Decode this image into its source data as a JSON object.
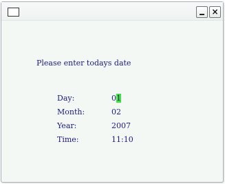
{
  "window": {
    "minimize_label": "_",
    "close_label": "×"
  },
  "prompt": "Please enter todays date",
  "fields": {
    "day": {
      "label": "Day:",
      "value_prefix": "0",
      "value_cursor": "1"
    },
    "month": {
      "label": "Month:",
      "value": "02"
    },
    "year": {
      "label": "Year:",
      "value": "2007"
    },
    "time": {
      "label": "Time:",
      "value": "11:10"
    }
  },
  "colors": {
    "text": "#1a1a7a",
    "cursor": "#3fe23f",
    "background": "#f3f8f5"
  }
}
